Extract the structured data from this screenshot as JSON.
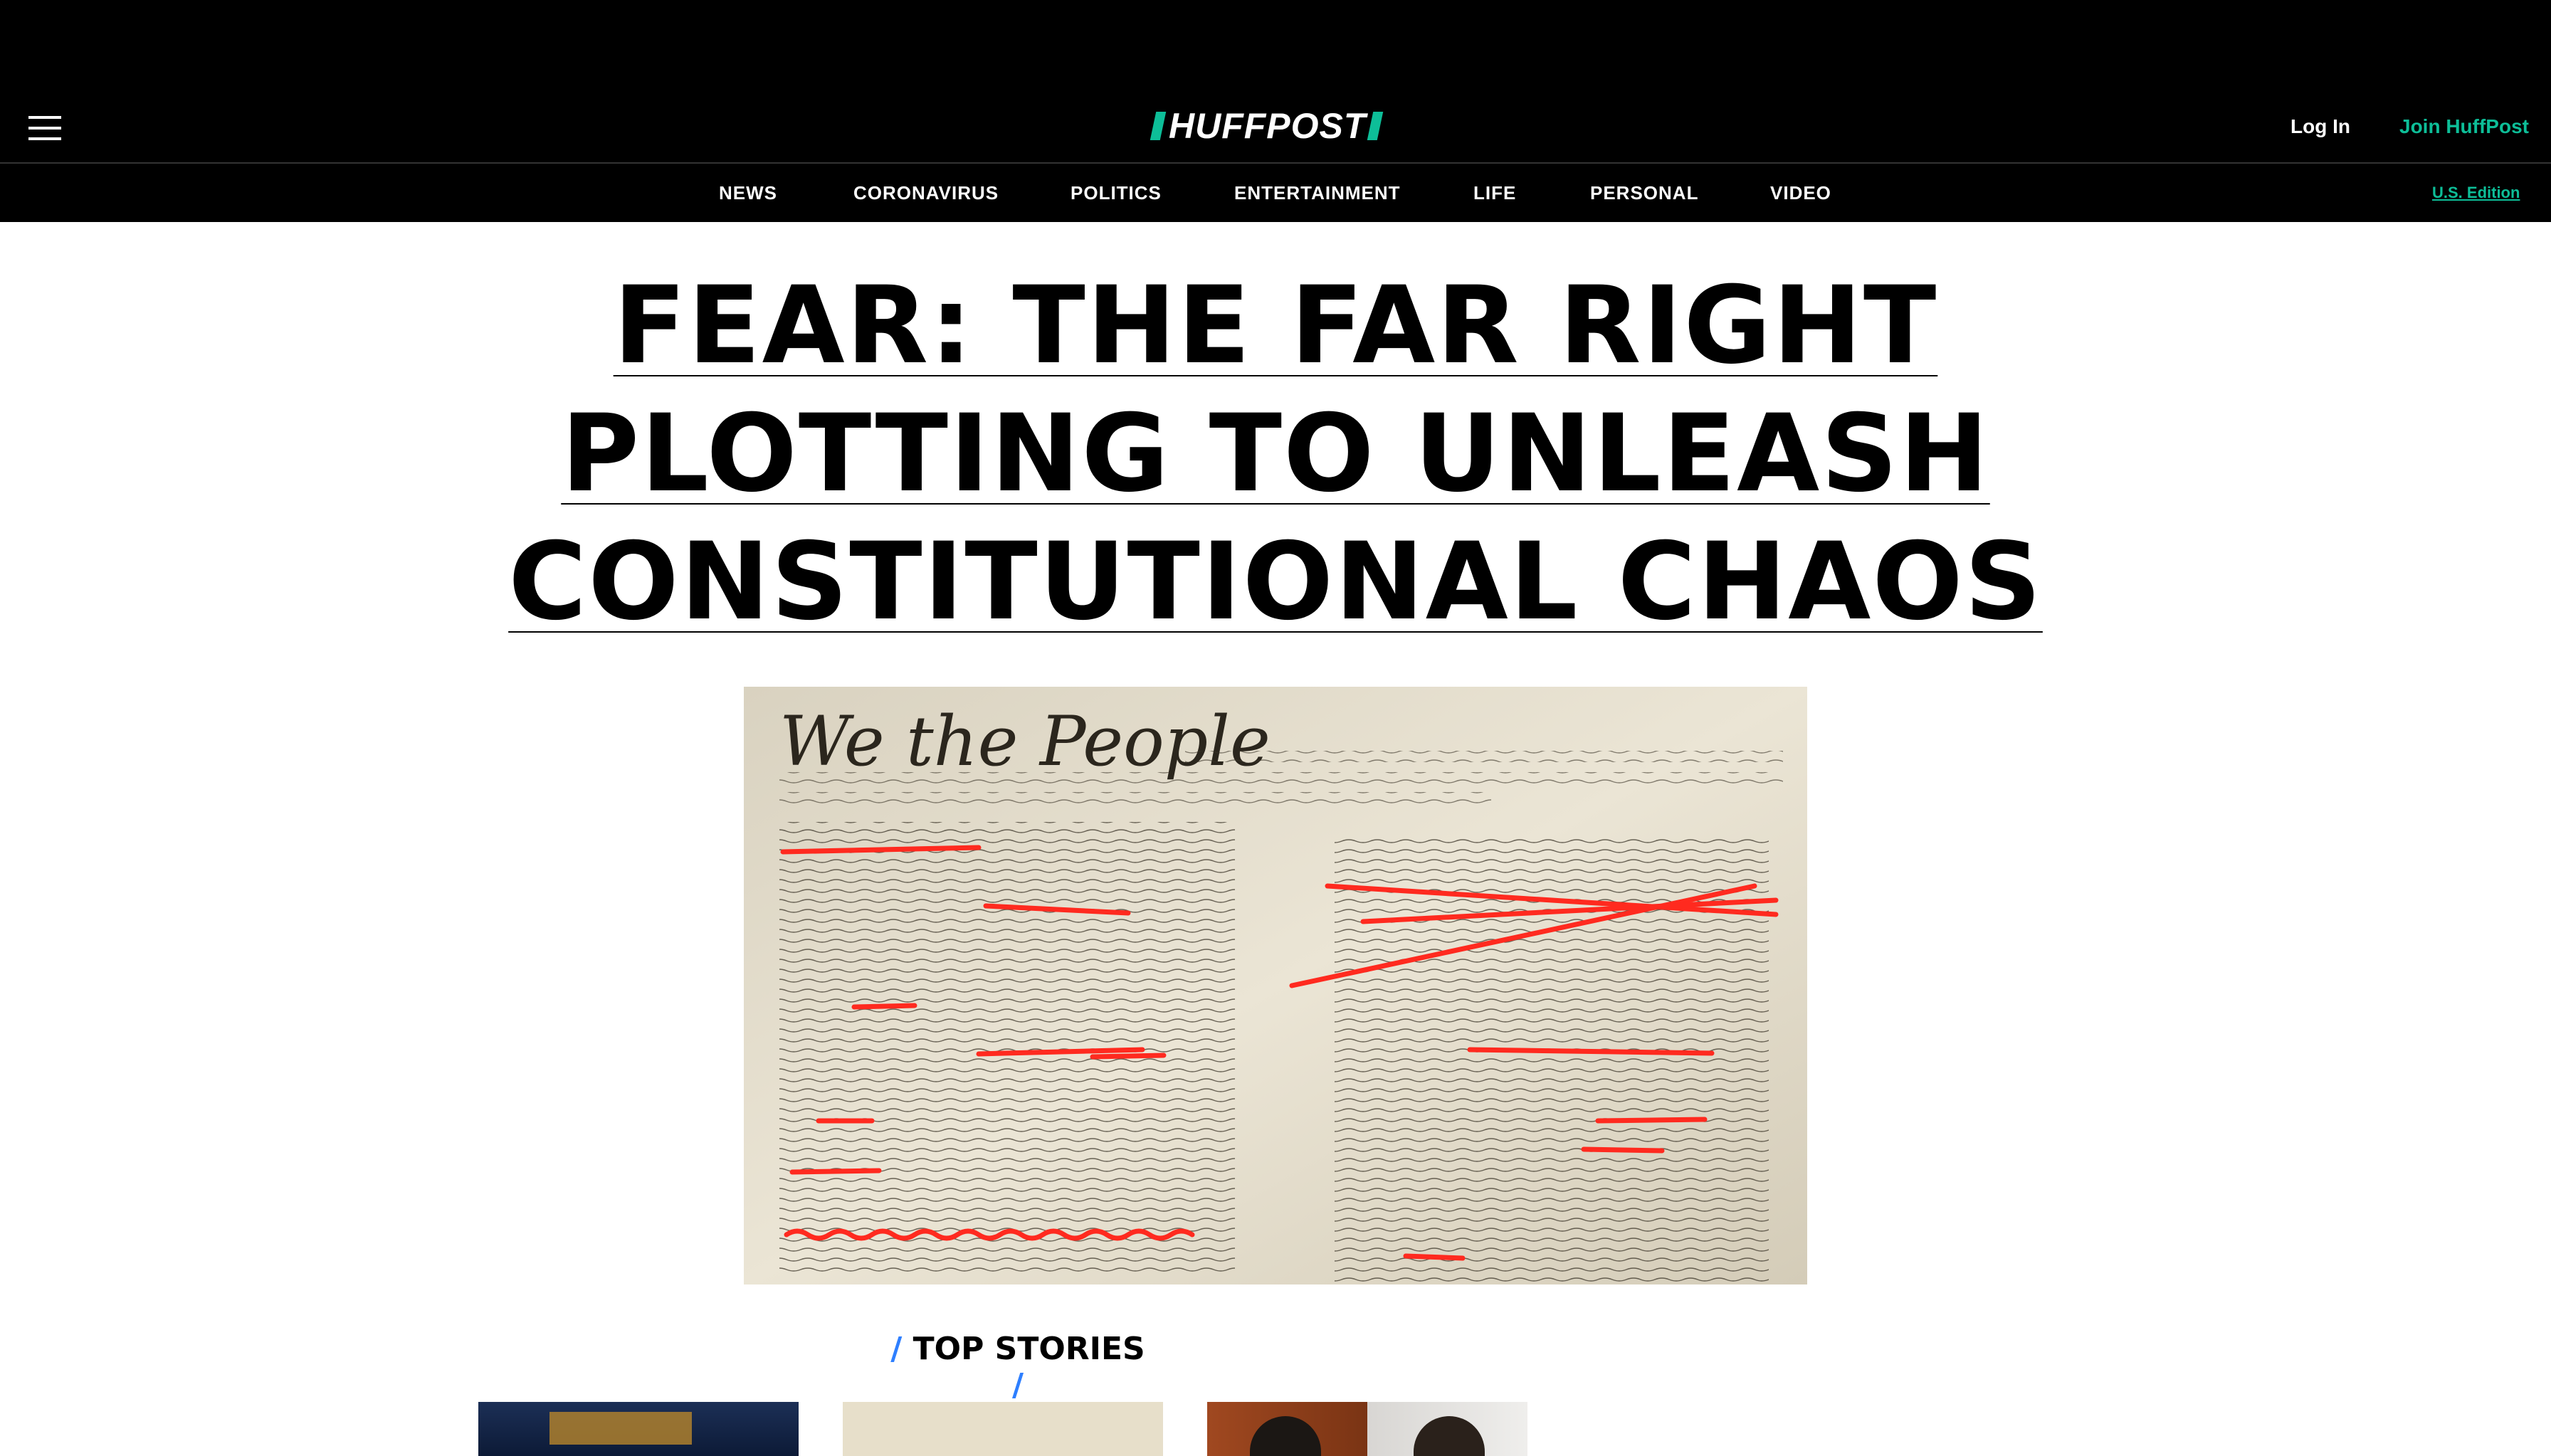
{
  "header": {
    "logo_text": "HUFFPOST",
    "login_label": "Log In",
    "join_label": "Join HuffPost",
    "edition_label": "U.S. Edition"
  },
  "nav": {
    "items": [
      "NEWS",
      "CORONAVIRUS",
      "POLITICS",
      "ENTERTAINMENT",
      "LIFE",
      "PERSONAL",
      "VIDEO"
    ]
  },
  "headline": {
    "lines": [
      "FEAR: THE FAR RIGHT",
      "PLOTTING TO UNLEASH",
      "CONSTITUTIONAL CHAOS"
    ]
  },
  "hero": {
    "script_heading": "We the People"
  },
  "top_stories": {
    "label": "TOP STORIES",
    "slash": "/"
  },
  "colors": {
    "brand_green": "#0dbe98",
    "accent_blue": "#2e7fff",
    "header_bg": "#000000"
  },
  "icons": {
    "menu": "hamburger-icon",
    "logo": "huffpost-logo-icon"
  }
}
